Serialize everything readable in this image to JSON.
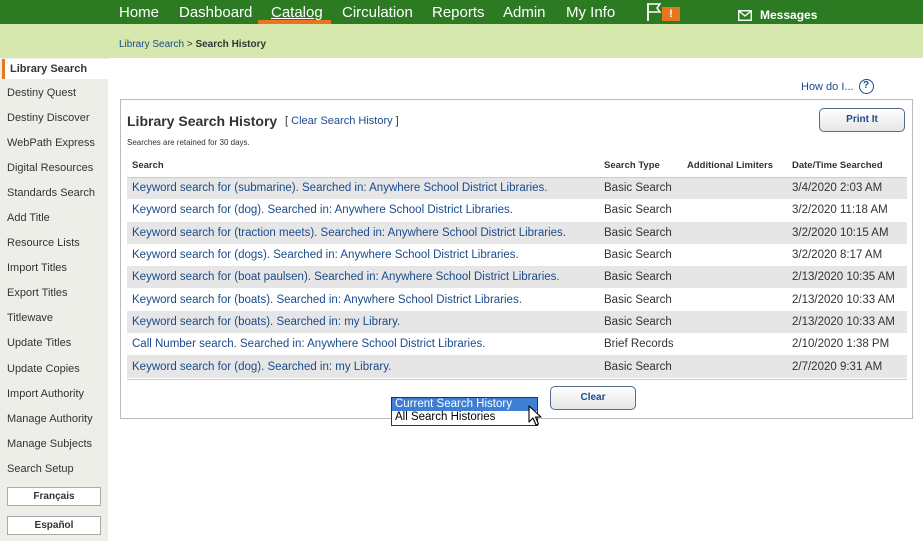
{
  "nav": {
    "items": [
      {
        "label": "Home"
      },
      {
        "label": "Dashboard"
      },
      {
        "label": "Catalog"
      },
      {
        "label": "Circulation"
      },
      {
        "label": "Reports"
      },
      {
        "label": "Admin"
      },
      {
        "label": "My Info"
      }
    ],
    "active": "Catalog",
    "flag_badge": "!",
    "messages_label": "Messages"
  },
  "breadcrumb": {
    "parent": "Library Search",
    "separator": ">",
    "current": "Search History"
  },
  "sidebar": {
    "items": [
      {
        "label": "Library Search"
      },
      {
        "label": "Destiny Quest"
      },
      {
        "label": "Destiny Discover"
      },
      {
        "label": "WebPath Express"
      },
      {
        "label": "Digital Resources"
      },
      {
        "label": "Standards Search"
      },
      {
        "label": "Add Title"
      },
      {
        "label": "Resource Lists"
      },
      {
        "label": "Import Titles"
      },
      {
        "label": "Export Titles"
      },
      {
        "label": "Titlewave"
      },
      {
        "label": "Update Titles"
      },
      {
        "label": "Update Copies"
      },
      {
        "label": "Import Authority"
      },
      {
        "label": "Manage Authority"
      },
      {
        "label": "Manage Subjects"
      },
      {
        "label": "Search Setup"
      }
    ],
    "lang_buttons": [
      "Français",
      "Español"
    ]
  },
  "help": {
    "label": "How do I...",
    "icon": "question-icon"
  },
  "panel": {
    "title": "Library Search History",
    "clear_open": "[",
    "clear_link": "Clear Search History",
    "clear_close": "]",
    "retained_note": "Searches are retained for 30 days.",
    "print_button": "Print It",
    "columns": [
      "Search",
      "Search Type",
      "Additional Limiters",
      "Date/Time Searched"
    ],
    "rows": [
      {
        "search": "Keyword search for (submarine). Searched in: Anywhere School District Libraries.",
        "type": "Basic Search",
        "limiters": "",
        "date": "3/4/2020 2:03 AM"
      },
      {
        "search": "Keyword search for (dog). Searched in: Anywhere School District Libraries.",
        "type": "Basic Search",
        "limiters": "",
        "date": "3/2/2020 11:18 AM"
      },
      {
        "search": "Keyword search for (traction meets). Searched in: Anywhere School District Libraries.",
        "type": "Basic Search",
        "limiters": "",
        "date": "3/2/2020 10:15 AM"
      },
      {
        "search": "Keyword search for (dogs). Searched in: Anywhere School District Libraries.",
        "type": "Basic Search",
        "limiters": "",
        "date": "3/2/2020 8:17 AM"
      },
      {
        "search": "Keyword search for (boat paulsen). Searched in: Anywhere School District Libraries.",
        "type": "Basic Search",
        "limiters": "",
        "date": "2/13/2020 10:35 AM"
      },
      {
        "search": "Keyword search for (boats). Searched in: Anywhere School District Libraries.",
        "type": "Basic Search",
        "limiters": "",
        "date": "2/13/2020 10:33 AM"
      },
      {
        "search": "Keyword search for (boats). Searched in: my Library.",
        "type": "Basic Search",
        "limiters": "",
        "date": "2/13/2020 10:33 AM"
      },
      {
        "search": "Call Number search. Searched in: Anywhere School District Libraries.",
        "type": "Brief Records",
        "limiters": "",
        "date": "2/10/2020 1:38 PM"
      },
      {
        "search": "Keyword search for (dog). Searched in: my Library.",
        "type": "Basic Search",
        "limiters": "",
        "date": "2/7/2020 9:31 AM"
      }
    ],
    "dropdown": {
      "options": [
        "Current Search History",
        "All Search Histories"
      ],
      "selected": "Current Search History"
    },
    "clear_button": "Clear"
  },
  "colors": {
    "nav_bg": "#2c7a22",
    "accent": "#e8761e",
    "crumb_bg": "#d6e8ad",
    "link": "#1a4b8c"
  }
}
